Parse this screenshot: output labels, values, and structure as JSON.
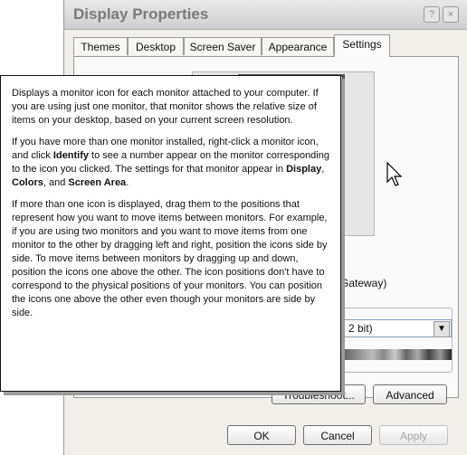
{
  "window": {
    "title": "Display Properties",
    "help_glyph": "?",
    "close_glyph": "×"
  },
  "tabs": [
    {
      "label": "Themes"
    },
    {
      "label": "Desktop"
    },
    {
      "label": "Screen Saver"
    },
    {
      "label": "Appearance"
    },
    {
      "label": "Settings",
      "active": true
    }
  ],
  "settings": {
    "display_fragment": "Gateway)",
    "colors_value": "2 bit)"
  },
  "buttons": {
    "troubleshoot": "Troubleshoot...",
    "advanced": "Advanced",
    "ok": "OK",
    "cancel": "Cancel",
    "apply": "Apply"
  },
  "tooltip": {
    "p1": "Displays a monitor icon for each monitor attached to your computer. If you are using just one monitor, that monitor shows the relative size of items on your desktop, based on your current screen resolution.",
    "p2": {
      "a": "If you have more than one monitor installed, right-click a monitor icon, and click ",
      "b": "Identify",
      "c": " to see a number appear on the monitor corresponding to the icon you clicked. The settings for that monitor appear in ",
      "d": "Display",
      "e": ", ",
      "f": "Colors",
      "g": ", and ",
      "h": "Screen Area",
      "i": "."
    },
    "p3": "If more than one icon is displayed, drag them to the positions that represent how you want to move items between monitors. For example, if you are using two monitors and you want to move items from one monitor to the other by dragging left and right, position the icons side by side. To move items between monitors by dragging up and down, position the icons one above the other. The icon positions don't have to correspond to the physical positions of your monitors. You can position the icons one above the other even though your monitors are side by side."
  },
  "icons": {
    "help": "help-icon",
    "close": "close-icon",
    "dropdown": "chevron-down-icon",
    "cursor": "arrow-cursor-icon"
  }
}
